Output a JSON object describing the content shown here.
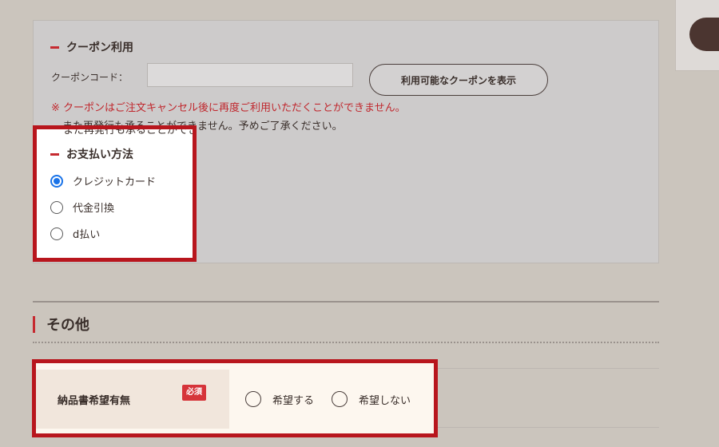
{
  "coupon": {
    "heading": "クーポン利用",
    "code_label": "クーポンコード：",
    "input_value": "",
    "show_button": "利用可能なクーポンを表示",
    "notice_red": "※ クーポンはご注文キャンセル後に再度ご利用いただくことができません。",
    "notice_line2": "また再発行も承ることができません。予めご了承ください。"
  },
  "payment": {
    "heading": "お支払い方法",
    "options": [
      {
        "label": "クレジットカード",
        "selected": true
      },
      {
        "label": "代金引換",
        "selected": false
      },
      {
        "label": "d払い",
        "selected": false
      }
    ]
  },
  "other": {
    "title": "その他",
    "delivery_label": "納品書希望有無",
    "required_badge": "必須",
    "options": [
      {
        "label": "希望する",
        "selected": false
      },
      {
        "label": "希望しない",
        "selected": false
      }
    ]
  },
  "colors": {
    "accent_red": "#c62a30",
    "highlight_border": "#b8161d",
    "radio_selected": "#1a73e8"
  }
}
